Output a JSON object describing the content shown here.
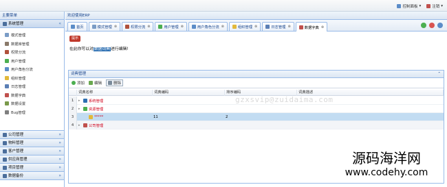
{
  "topbar": {
    "control_panel_label": "控制面板",
    "logout_label": "注销"
  },
  "sidebar": {
    "title": "主要菜单",
    "open_section": "系统管理",
    "items": [
      {
        "label": "模式管理",
        "icon": "form-icon",
        "color": "#7a9cc6"
      },
      {
        "label": "数据库管理",
        "icon": "database-icon",
        "color": "#8a7a6a"
      },
      {
        "label": "权限分流",
        "icon": "shield-x-icon",
        "color": "#b0503a"
      },
      {
        "label": "用户管理",
        "icon": "plus-icon",
        "color": "#4caf50"
      },
      {
        "label": "用户角色分流",
        "icon": "users-icon",
        "color": "#5b8cc8"
      },
      {
        "label": "组织管理",
        "icon": "bulb-icon",
        "color": "#e2b93b"
      },
      {
        "label": "日志管理",
        "icon": "log-icon",
        "color": "#5b7fb5"
      },
      {
        "label": "数据字典",
        "icon": "dictionary-icon",
        "color": "#c0504d"
      },
      {
        "label": "数据设置",
        "icon": "grid-icon",
        "color": "#7a9a4a"
      },
      {
        "label": "Bug管理",
        "icon": "bug-icon",
        "color": "#7f7f7f"
      }
    ],
    "sections": [
      {
        "label": "公司管理"
      },
      {
        "label": "物料管理"
      },
      {
        "label": "客户管理"
      },
      {
        "label": "供应商管理"
      },
      {
        "label": "项目管理"
      },
      {
        "label": "数据备份"
      }
    ]
  },
  "main": {
    "welcome": "欢迎使用ERP",
    "tabs": [
      {
        "label": "首页",
        "icon": "home-icon",
        "color": "#5b8cc8",
        "closable": false
      },
      {
        "label": "模式管理",
        "icon": "form-icon",
        "color": "#7a9cc6",
        "closable": true
      },
      {
        "label": "权限分流",
        "icon": "shield-x-icon",
        "color": "#b0503a",
        "closable": true
      },
      {
        "label": "用户管理",
        "icon": "plus-icon",
        "color": "#4caf50",
        "closable": true
      },
      {
        "label": "用户角色分流",
        "icon": "users-icon",
        "color": "#5b8cc8",
        "closable": true
      },
      {
        "label": "组织管理",
        "icon": "bulb-icon",
        "color": "#e2b93b",
        "closable": true
      },
      {
        "label": "日志管理",
        "icon": "log-icon",
        "color": "#5b7fb5",
        "closable": true
      },
      {
        "label": "数据字典",
        "icon": "dictionary-icon",
        "color": "#c0504d",
        "closable": true
      }
    ],
    "hint": {
      "badge": "提示",
      "before": "在此你可以对",
      "highlight": "数据词典",
      "after": "进行编辑!"
    },
    "grid_panel": {
      "title": "词典管理",
      "toolbar": {
        "add_label": "添加",
        "edit_label": "编辑",
        "delete_label": "删除"
      },
      "columns": [
        "词典名称",
        "词典编码",
        "排序编码",
        "词典描述"
      ],
      "rows": [
        {
          "num": "1",
          "name": "系统管理",
          "code": "",
          "sort": "",
          "icon_color": "#2c6fb2",
          "expander": "▸"
        },
        {
          "num": "2",
          "name": "资源管理",
          "code": "",
          "sort": "",
          "icon_color": "#4caf50",
          "expander": "▸"
        },
        {
          "num": "3",
          "name": "*****",
          "code": "11",
          "sort": "2",
          "icon_color": "#e2b93b",
          "expander": ""
        },
        {
          "num": "4",
          "name": "公司管理",
          "code": "",
          "sort": "",
          "icon_color": "#c0504d",
          "expander": "▸"
        }
      ]
    }
  },
  "watermark": "gzxsvip@zuidaima.com",
  "site_watermark": {
    "line1": "源码海洋网",
    "line2": "www.codehy.com"
  }
}
